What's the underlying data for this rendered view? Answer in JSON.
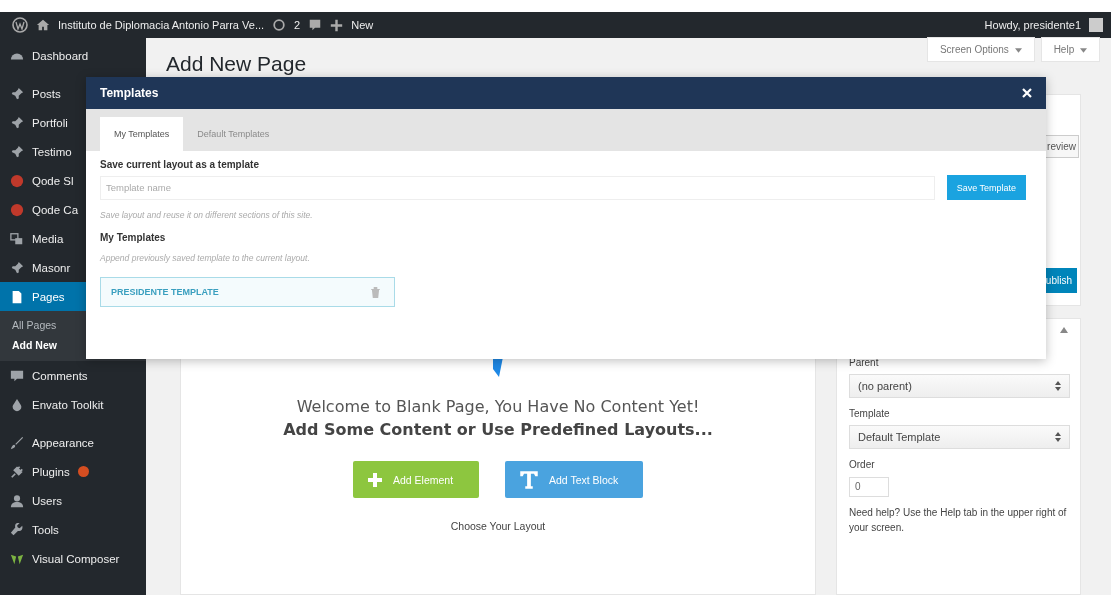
{
  "admin_bar": {
    "site_name": "Instituto de Diplomacia Antonio Parra Ve...",
    "updates": "2",
    "new": "New",
    "greeting": "Howdy, presidente1"
  },
  "sidebar": {
    "items": [
      {
        "label": "Dashboard",
        "selected": false,
        "update_badge": false
      },
      {
        "label": "Posts",
        "selected": false,
        "update_badge": false
      },
      {
        "label": "Portfoli",
        "selected": false,
        "update_badge": false
      },
      {
        "label": "Testimo",
        "selected": false,
        "update_badge": false
      },
      {
        "label": "Qode Sl",
        "selected": false,
        "update_badge": false
      },
      {
        "label": "Qode Ca",
        "selected": false,
        "update_badge": false
      },
      {
        "label": "Media",
        "selected": false,
        "update_badge": false
      },
      {
        "label": "Masonr",
        "selected": false,
        "update_badge": false
      },
      {
        "label": "Pages",
        "selected": true,
        "update_badge": false,
        "children": [
          {
            "label": "All Pages",
            "selected": false
          },
          {
            "label": "Add New",
            "selected": true
          }
        ]
      },
      {
        "label": "Comments",
        "selected": false,
        "update_badge": false
      },
      {
        "label": "Envato Toolkit",
        "selected": false,
        "update_badge": false
      },
      {
        "label": "Appearance",
        "selected": false,
        "update_badge": false
      },
      {
        "label": "Plugins",
        "selected": false,
        "update_badge": true
      },
      {
        "label": "Users",
        "selected": false,
        "update_badge": false
      },
      {
        "label": "Tools",
        "selected": false,
        "update_badge": false
      },
      {
        "label": "Visual Composer",
        "selected": false,
        "update_badge": false
      }
    ]
  },
  "page": {
    "title": "Add New Page",
    "screen_options": "Screen Options",
    "help": "Help"
  },
  "editor": {
    "welcome": "Welcome to Blank Page, You Have No Content Yet!",
    "prompt": "Add Some Content or Use Predefined Layouts...",
    "buttons": [
      {
        "label": "Add Element",
        "kind": "element"
      },
      {
        "label": "Add Text Block",
        "kind": "text"
      }
    ],
    "layout_heading": "Choose Your Layout"
  },
  "publish_box": {
    "preview": "review",
    "publish": "ublish"
  },
  "attributes": {
    "parent_label": "Parent",
    "parent": "(no parent)",
    "template_label": "Template",
    "template": "Default Template",
    "order_label": "Order",
    "order": "0",
    "help": "Need help? Use the Help tab in the upper right of your screen."
  },
  "modal": {
    "title": "Templates",
    "tabs": [
      {
        "label": "My Templates",
        "selected": true
      },
      {
        "label": "Default Templates",
        "selected": false
      }
    ],
    "save_label": "Save current layout as a template",
    "name_field": {
      "placeholder": "Template name"
    },
    "save_button": "Save Template",
    "save_hint": "Save layout and reuse it on different sections of this site.",
    "list_heading": "My Templates",
    "list_hint": "Append previously saved template to the current layout.",
    "templates": [
      {
        "name": "PRESIDENTE TEMPLATE"
      }
    ]
  }
}
